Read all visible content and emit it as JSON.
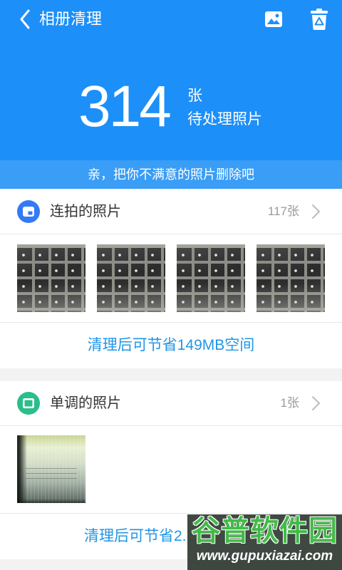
{
  "colors": {
    "header_bg": "#1d8ff8",
    "banner_bg": "#3a9df6",
    "link_text": "#2196e6",
    "burst_icon": "#3479f5",
    "mono_icon": "#2bbd8a",
    "page_bg": "#f2f2f2"
  },
  "header": {
    "back_icon": "chevron-left-icon",
    "title": "相册清理",
    "gallery_icon": "gallery-icon",
    "trash_icon": "recycle-bin-icon"
  },
  "summary": {
    "count": "314",
    "unit": "张",
    "caption": "待处理照片"
  },
  "banner": {
    "text": "亲，把你不满意的照片删除吧"
  },
  "groups": [
    {
      "icon": "burst-photos-icon",
      "title": "连拍的照片",
      "count": "117张",
      "chevron_icon": "chevron-right-icon",
      "savings": "清理后可节省149MB空间"
    },
    {
      "icon": "monotone-photos-icon",
      "title": "单调的照片",
      "count": "1张",
      "chevron_icon": "chevron-right-icon",
      "savings": "清理后可节省2."
    }
  ],
  "watermark": {
    "title": "谷普软件园",
    "url": "www.gupuxiazai.com"
  }
}
